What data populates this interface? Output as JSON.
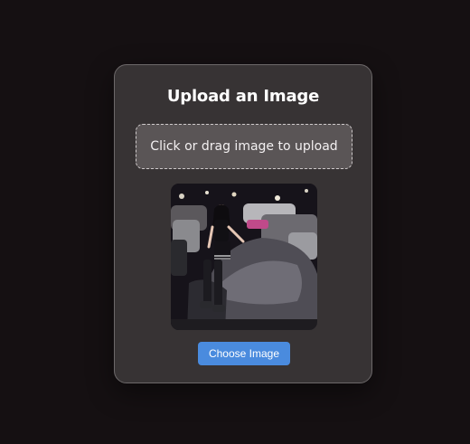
{
  "card": {
    "title": "Upload an Image",
    "dropzone_text": "Click or drag image to upload",
    "choose_button_label": "Choose Image"
  },
  "preview": {
    "description_icon": "uploaded-photo"
  },
  "colors": {
    "background": "#151012",
    "card": "#373334",
    "dropzone": "#5a5556",
    "button": "#4a8bde"
  }
}
